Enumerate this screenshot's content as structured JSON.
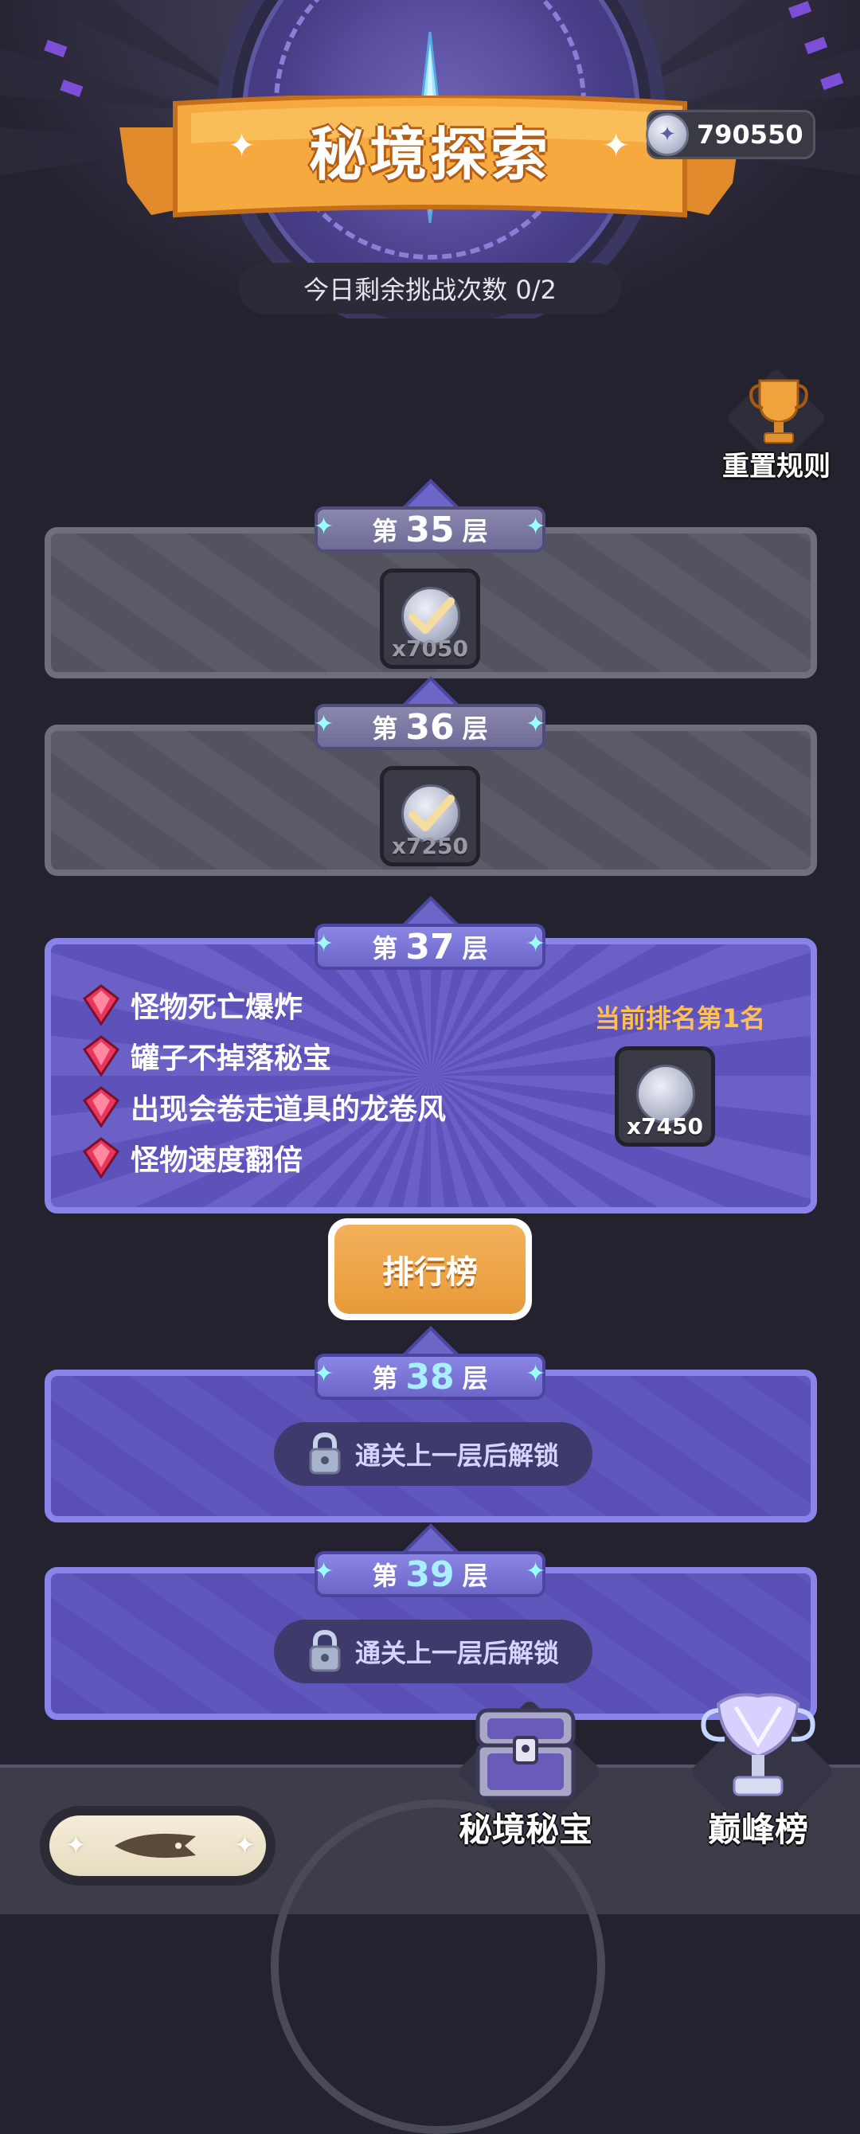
{
  "header": {
    "title": "秘境探索",
    "currency_value": "790550",
    "attempts_text": "今日剩余挑战次数 0/2"
  },
  "rules": {
    "label": "重置规则"
  },
  "floors": [
    {
      "prefix": "第",
      "number": "35",
      "suffix": "层",
      "status": "completed",
      "reward_qty": "x7050"
    },
    {
      "prefix": "第",
      "number": "36",
      "suffix": "层",
      "status": "completed",
      "reward_qty": "x7250"
    },
    {
      "prefix": "第",
      "number": "37",
      "suffix": "层",
      "status": "current",
      "modifiers": [
        "怪物死亡爆炸",
        "罐子不掉落秘宝",
        "出现会卷走道具的龙卷风",
        "怪物速度翻倍"
      ],
      "rank_text": "当前排名第1名",
      "reward_qty": "x7450"
    },
    {
      "prefix": "第",
      "number": "38",
      "suffix": "层",
      "status": "locked",
      "lock_text": "通关上一层后解锁"
    },
    {
      "prefix": "第",
      "number": "39",
      "suffix": "层",
      "status": "locked",
      "lock_text": "通关上一层后解锁"
    }
  ],
  "ranking_button": {
    "label": "排行榜"
  },
  "bottom_nav": {
    "treasure_label": "秘境秘宝",
    "peak_label": "巅峰榜"
  },
  "colors": {
    "accent_orange": "#e89a3a",
    "floor_purple": "#5a4fb4",
    "floor_border": "#8a84ea",
    "rank_text": "#ffbf57"
  }
}
